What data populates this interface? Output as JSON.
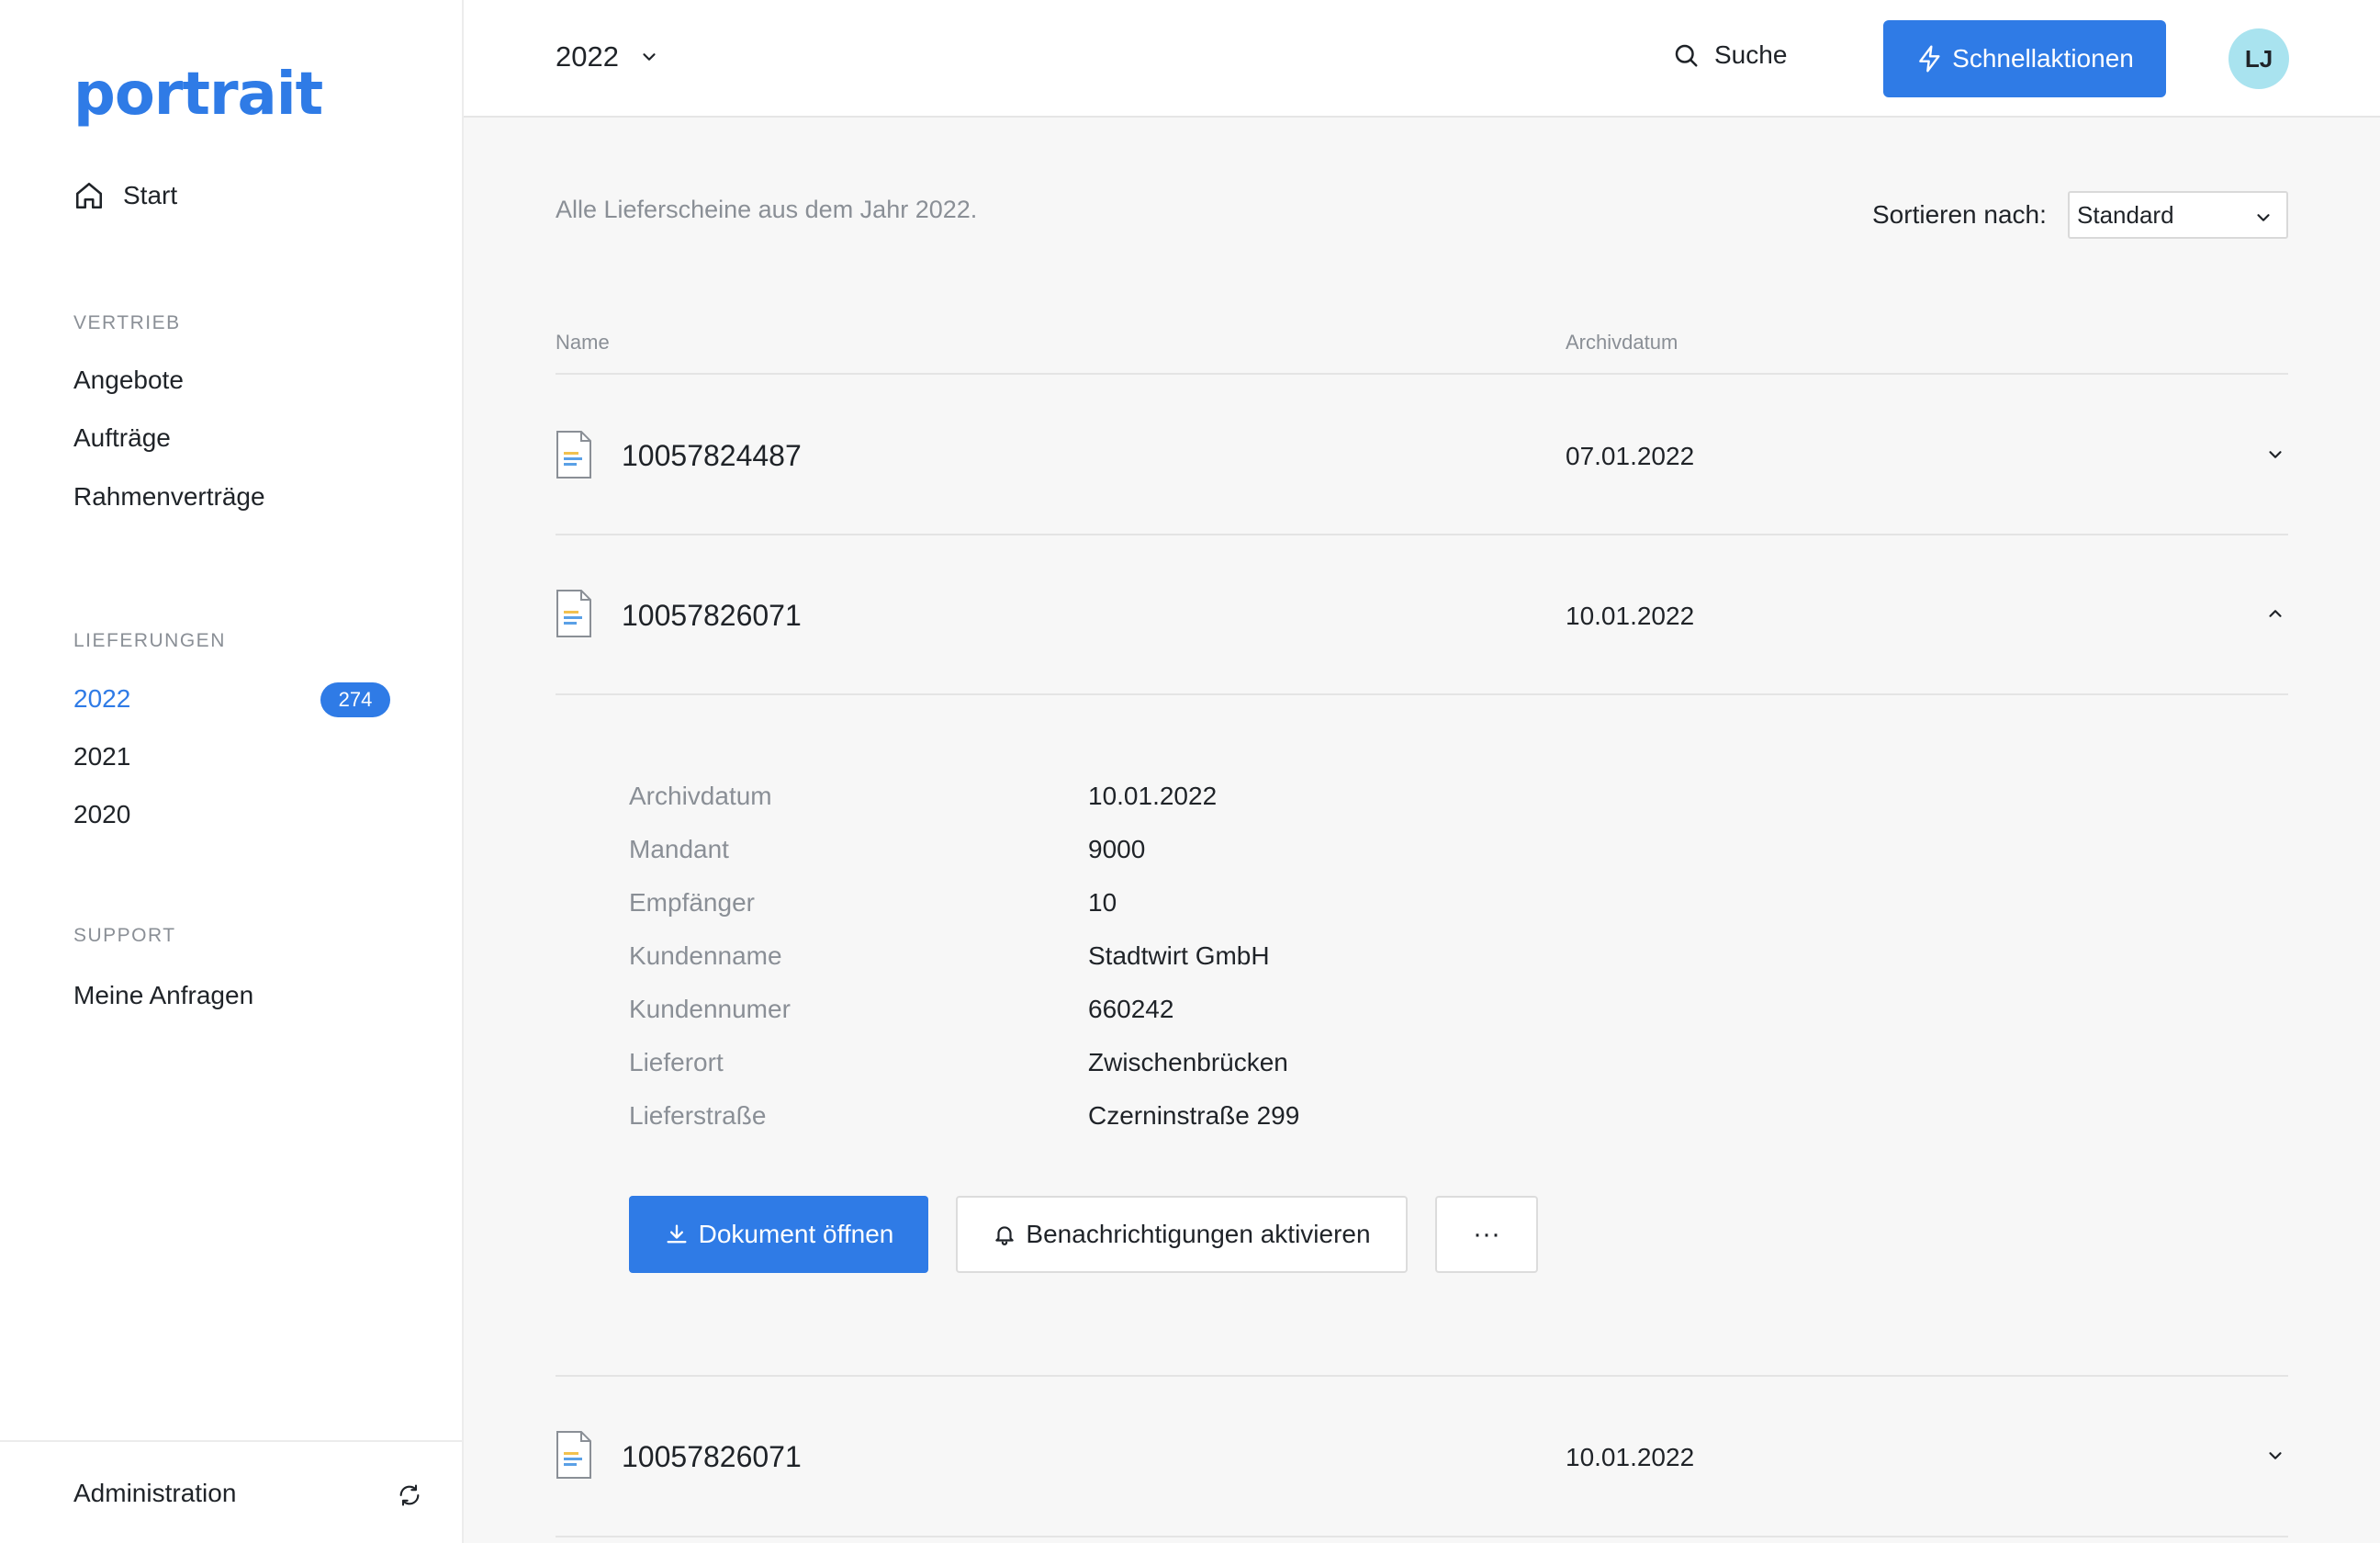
{
  "brand": {
    "logo": "portrait"
  },
  "sidebar": {
    "start_label": "Start",
    "sections": [
      {
        "label": "VERTRIEB",
        "items": [
          "Angebote",
          "Aufträge",
          "Rahmenverträge"
        ]
      },
      {
        "label": "LIEFERUNGEN",
        "items": [
          "2022",
          "2021",
          "2020"
        ],
        "active": "2022",
        "active_count": "274"
      },
      {
        "label": "SUPPORT",
        "items": [
          "Meine Anfragen"
        ]
      }
    ],
    "footer_label": "Administration"
  },
  "topbar": {
    "year": "2022",
    "search_label": "Suche",
    "quick_actions_label": "Schnellaktionen",
    "avatar_initials": "LJ"
  },
  "content": {
    "intro": "Alle Lieferscheine aus dem Jahr 2022.",
    "sort_label": "Sortieren nach:",
    "sort_value": "Standard",
    "columns": {
      "name": "Name",
      "date": "Archivdatum"
    },
    "rows": [
      {
        "name": "10057824487",
        "date": "07.01.2022",
        "expanded": false
      },
      {
        "name": "10057826071",
        "date": "10.01.2022",
        "expanded": true
      },
      {
        "name": "10057826071",
        "date": "10.01.2022",
        "expanded": false
      }
    ],
    "details": [
      {
        "label": "Archivdatum",
        "value": "10.01.2022"
      },
      {
        "label": "Mandant",
        "value": "9000"
      },
      {
        "label": "Empfänger",
        "value": "10"
      },
      {
        "label": "Kundenname",
        "value": "Stadtwirt GmbH"
      },
      {
        "label": "Kundennumer",
        "value": "660242"
      },
      {
        "label": "Lieferort",
        "value": "Zwischenbrücken"
      },
      {
        "label": "Lieferstraße",
        "value": "Czerninstraße 299"
      }
    ],
    "actions": {
      "open": "Dokument öffnen",
      "notify": "Benachrichtigungen aktivieren",
      "more": "···"
    }
  },
  "colors": {
    "accent": "#2f7be6",
    "avatar_bg": "#a9e3ef",
    "muted": "#8a8f96"
  }
}
